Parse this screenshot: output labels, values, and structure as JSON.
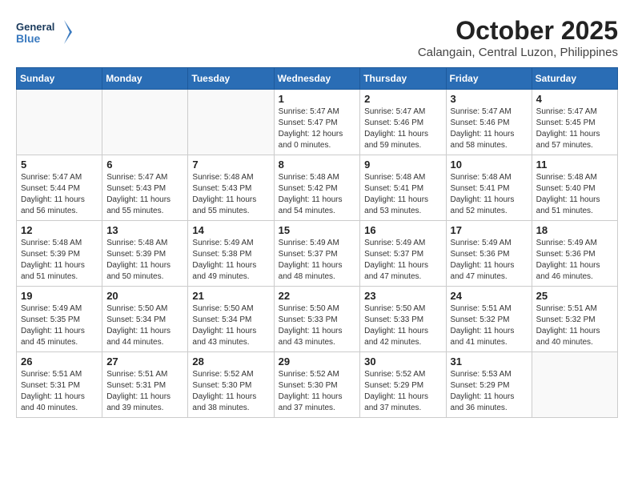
{
  "header": {
    "logo_line1": "General",
    "logo_line2": "Blue",
    "month": "October 2025",
    "location": "Calangain, Central Luzon, Philippines"
  },
  "weekdays": [
    "Sunday",
    "Monday",
    "Tuesday",
    "Wednesday",
    "Thursday",
    "Friday",
    "Saturday"
  ],
  "weeks": [
    [
      {
        "day": "",
        "content": ""
      },
      {
        "day": "",
        "content": ""
      },
      {
        "day": "",
        "content": ""
      },
      {
        "day": "1",
        "content": "Sunrise: 5:47 AM\nSunset: 5:47 PM\nDaylight: 12 hours\nand 0 minutes."
      },
      {
        "day": "2",
        "content": "Sunrise: 5:47 AM\nSunset: 5:46 PM\nDaylight: 11 hours\nand 59 minutes."
      },
      {
        "day": "3",
        "content": "Sunrise: 5:47 AM\nSunset: 5:46 PM\nDaylight: 11 hours\nand 58 minutes."
      },
      {
        "day": "4",
        "content": "Sunrise: 5:47 AM\nSunset: 5:45 PM\nDaylight: 11 hours\nand 57 minutes."
      }
    ],
    [
      {
        "day": "5",
        "content": "Sunrise: 5:47 AM\nSunset: 5:44 PM\nDaylight: 11 hours\nand 56 minutes."
      },
      {
        "day": "6",
        "content": "Sunrise: 5:47 AM\nSunset: 5:43 PM\nDaylight: 11 hours\nand 55 minutes."
      },
      {
        "day": "7",
        "content": "Sunrise: 5:48 AM\nSunset: 5:43 PM\nDaylight: 11 hours\nand 55 minutes."
      },
      {
        "day": "8",
        "content": "Sunrise: 5:48 AM\nSunset: 5:42 PM\nDaylight: 11 hours\nand 54 minutes."
      },
      {
        "day": "9",
        "content": "Sunrise: 5:48 AM\nSunset: 5:41 PM\nDaylight: 11 hours\nand 53 minutes."
      },
      {
        "day": "10",
        "content": "Sunrise: 5:48 AM\nSunset: 5:41 PM\nDaylight: 11 hours\nand 52 minutes."
      },
      {
        "day": "11",
        "content": "Sunrise: 5:48 AM\nSunset: 5:40 PM\nDaylight: 11 hours\nand 51 minutes."
      }
    ],
    [
      {
        "day": "12",
        "content": "Sunrise: 5:48 AM\nSunset: 5:39 PM\nDaylight: 11 hours\nand 51 minutes."
      },
      {
        "day": "13",
        "content": "Sunrise: 5:48 AM\nSunset: 5:39 PM\nDaylight: 11 hours\nand 50 minutes."
      },
      {
        "day": "14",
        "content": "Sunrise: 5:49 AM\nSunset: 5:38 PM\nDaylight: 11 hours\nand 49 minutes."
      },
      {
        "day": "15",
        "content": "Sunrise: 5:49 AM\nSunset: 5:37 PM\nDaylight: 11 hours\nand 48 minutes."
      },
      {
        "day": "16",
        "content": "Sunrise: 5:49 AM\nSunset: 5:37 PM\nDaylight: 11 hours\nand 47 minutes."
      },
      {
        "day": "17",
        "content": "Sunrise: 5:49 AM\nSunset: 5:36 PM\nDaylight: 11 hours\nand 47 minutes."
      },
      {
        "day": "18",
        "content": "Sunrise: 5:49 AM\nSunset: 5:36 PM\nDaylight: 11 hours\nand 46 minutes."
      }
    ],
    [
      {
        "day": "19",
        "content": "Sunrise: 5:49 AM\nSunset: 5:35 PM\nDaylight: 11 hours\nand 45 minutes."
      },
      {
        "day": "20",
        "content": "Sunrise: 5:50 AM\nSunset: 5:34 PM\nDaylight: 11 hours\nand 44 minutes."
      },
      {
        "day": "21",
        "content": "Sunrise: 5:50 AM\nSunset: 5:34 PM\nDaylight: 11 hours\nand 43 minutes."
      },
      {
        "day": "22",
        "content": "Sunrise: 5:50 AM\nSunset: 5:33 PM\nDaylight: 11 hours\nand 43 minutes."
      },
      {
        "day": "23",
        "content": "Sunrise: 5:50 AM\nSunset: 5:33 PM\nDaylight: 11 hours\nand 42 minutes."
      },
      {
        "day": "24",
        "content": "Sunrise: 5:51 AM\nSunset: 5:32 PM\nDaylight: 11 hours\nand 41 minutes."
      },
      {
        "day": "25",
        "content": "Sunrise: 5:51 AM\nSunset: 5:32 PM\nDaylight: 11 hours\nand 40 minutes."
      }
    ],
    [
      {
        "day": "26",
        "content": "Sunrise: 5:51 AM\nSunset: 5:31 PM\nDaylight: 11 hours\nand 40 minutes."
      },
      {
        "day": "27",
        "content": "Sunrise: 5:51 AM\nSunset: 5:31 PM\nDaylight: 11 hours\nand 39 minutes."
      },
      {
        "day": "28",
        "content": "Sunrise: 5:52 AM\nSunset: 5:30 PM\nDaylight: 11 hours\nand 38 minutes."
      },
      {
        "day": "29",
        "content": "Sunrise: 5:52 AM\nSunset: 5:30 PM\nDaylight: 11 hours\nand 37 minutes."
      },
      {
        "day": "30",
        "content": "Sunrise: 5:52 AM\nSunset: 5:29 PM\nDaylight: 11 hours\nand 37 minutes."
      },
      {
        "day": "31",
        "content": "Sunrise: 5:53 AM\nSunset: 5:29 PM\nDaylight: 11 hours\nand 36 minutes."
      },
      {
        "day": "",
        "content": ""
      }
    ]
  ]
}
